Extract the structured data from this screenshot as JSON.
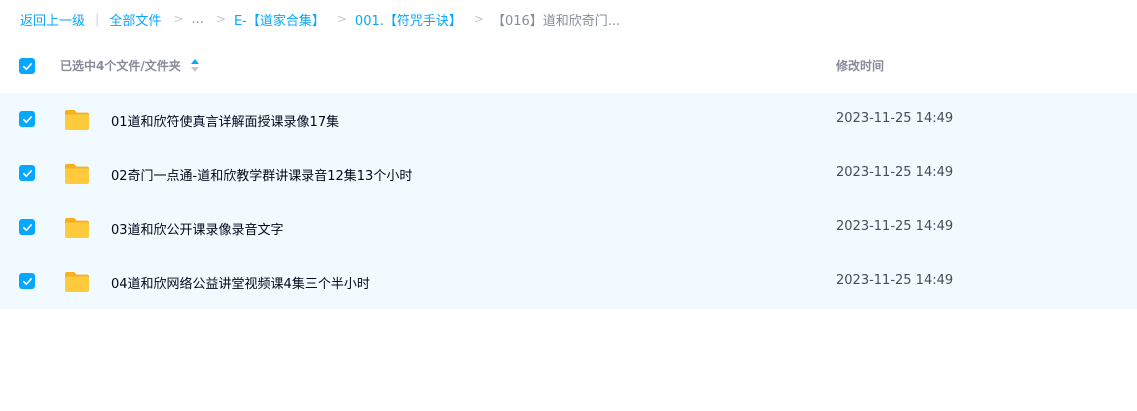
{
  "breadcrumb": {
    "back": "返回上一级",
    "all_files": "全部文件",
    "ellipsis": "...",
    "level1": "E-【道家合集】",
    "level2": "001.【符咒手诀】",
    "current": "【016】道和欣奇门..."
  },
  "header": {
    "selected_text": "已选中4个文件/文件夹",
    "time_col": "修改时间"
  },
  "files": [
    {
      "name": "01道和欣符使真言详解面授课录像17集",
      "time": "2023-11-25 14:49"
    },
    {
      "name": "02奇门一点通-道和欣教学群讲课录音12集13个小时",
      "time": "2023-11-25 14:49"
    },
    {
      "name": "03道和欣公开课录像录音文字",
      "time": "2023-11-25 14:49"
    },
    {
      "name": "04道和欣网络公益讲堂视频课4集三个半小时",
      "time": "2023-11-25 14:49"
    }
  ],
  "colors": {
    "accent": "#06a7ff",
    "row_bg": "#f0faff",
    "folder": "#ffc93c"
  },
  "icons": {
    "check": "check-icon",
    "sort": "sort-icon",
    "folder": "folder-icon"
  }
}
